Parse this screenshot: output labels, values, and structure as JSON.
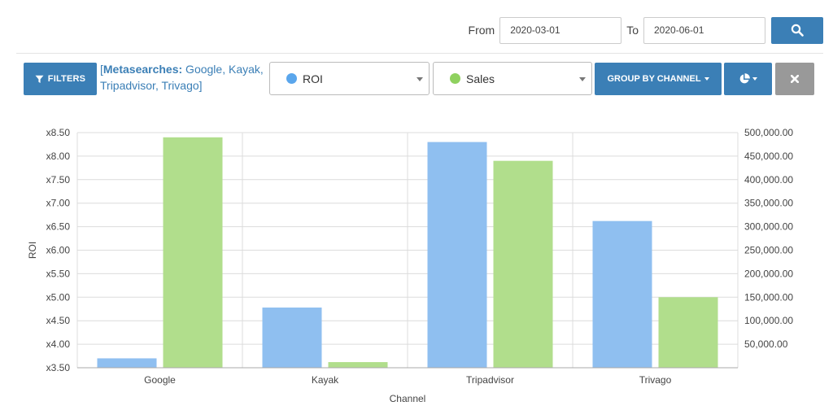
{
  "header": {
    "from_label": "From",
    "from_value": "2020-03-01",
    "to_label": "To",
    "to_value": "2020-06-01"
  },
  "toolbar": {
    "filters_label": "FILTERS",
    "filter_summary": {
      "open_bracket": "[",
      "key": "Metasearches:",
      "values": " Google, Kayak, Tripadvisor, Trivago",
      "close_bracket": "]"
    },
    "metric_1": {
      "selected": "ROI",
      "color": "#5aa6ec"
    },
    "metric_2": {
      "selected": "Sales",
      "color": "#8fd15f"
    },
    "group_label": "GROUP BY CHANNEL",
    "chart_type_icon": "pie-chart-icon",
    "close_icon": "close-icon"
  },
  "chart_data": {
    "type": "bar",
    "categories": [
      "Google",
      "Kayak",
      "Tripadvisor",
      "Trivago"
    ],
    "series": [
      {
        "name": "ROI",
        "axis": "left",
        "color": "#8fbff0",
        "values": [
          3.7,
          4.78,
          8.3,
          6.62
        ]
      },
      {
        "name": "Sales",
        "axis": "right",
        "color": "#b1de8c",
        "values": [
          490000,
          12000,
          440000,
          150000
        ]
      }
    ],
    "xlabel": "Channel",
    "ylabel": "ROI",
    "y_left": {
      "min": 3.5,
      "max": 8.5,
      "ticks": [
        3.5,
        4.0,
        4.5,
        5.0,
        5.5,
        6.0,
        6.5,
        7.0,
        7.5,
        8.0,
        8.5
      ],
      "tick_labels": [
        "x3.50",
        "x4.00",
        "x4.50",
        "x5.00",
        "x5.50",
        "x6.00",
        "x6.50",
        "x7.00",
        "x7.50",
        "x8.00",
        "x8.50"
      ]
    },
    "y_right": {
      "min": 0,
      "max": 500000,
      "ticks": [
        50000,
        100000,
        150000,
        200000,
        250000,
        300000,
        350000,
        400000,
        450000,
        500000
      ],
      "tick_labels": [
        "50,000.00",
        "100,000.00",
        "150,000.00",
        "200,000.00",
        "250,000.00",
        "300,000.00",
        "350,000.00",
        "400,000.00",
        "450,000.00",
        "500,000.00"
      ]
    },
    "grid": true
  }
}
